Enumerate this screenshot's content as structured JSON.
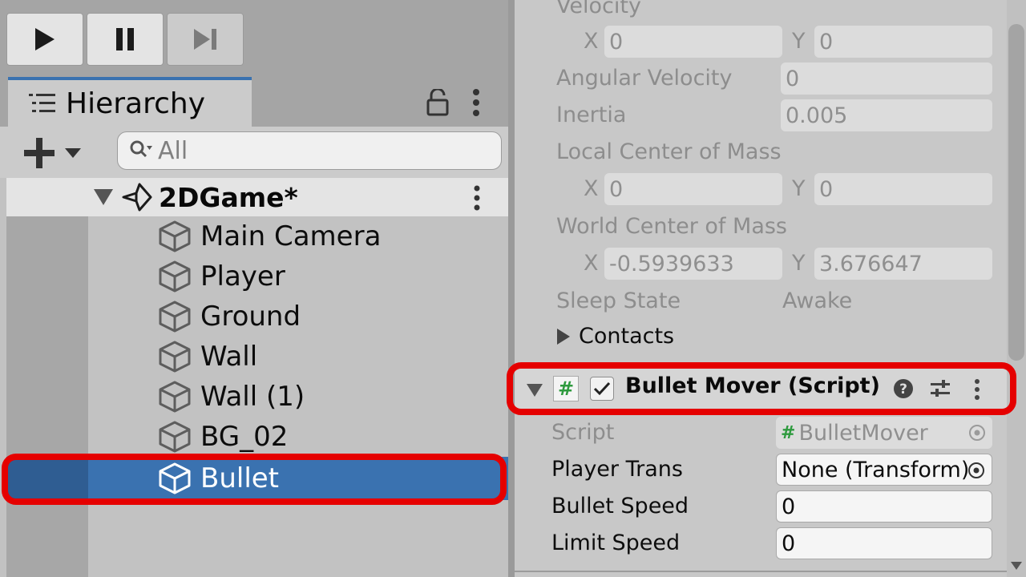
{
  "toolbar": {
    "play_icon": "play-icon",
    "pause_icon": "pause-icon",
    "step_icon": "step-icon"
  },
  "hierarchy": {
    "tab_label": "Hierarchy",
    "search_placeholder": "All",
    "scene_name": "2DGame*",
    "items": [
      {
        "label": "Main Camera"
      },
      {
        "label": "Player"
      },
      {
        "label": "Ground"
      },
      {
        "label": "Wall"
      },
      {
        "label": "Wall (1)"
      },
      {
        "label": "BG_02"
      },
      {
        "label": "Bullet"
      }
    ],
    "selected_item": "Bullet"
  },
  "inspector": {
    "rigidbody": {
      "velocity_label": "Velocity",
      "velocity": {
        "x_label": "X",
        "x": "0",
        "y_label": "Y",
        "y": "0"
      },
      "angular_velocity_label": "Angular Velocity",
      "angular_velocity": "0",
      "inertia_label": "Inertia",
      "inertia": "0.005",
      "local_com_label": "Local Center of Mass",
      "local_com": {
        "x_label": "X",
        "x": "0",
        "y_label": "Y",
        "y": "0"
      },
      "world_com_label": "World Center of Mass",
      "world_com": {
        "x_label": "X",
        "x": "-0.5939633",
        "y_label": "Y",
        "y": "3.676647"
      },
      "sleep_state_label": "Sleep State",
      "sleep_state": "Awake",
      "contacts_label": "Contacts"
    },
    "bullet_mover": {
      "title": "Bullet Mover (Script)",
      "enabled": true,
      "script_label": "Script",
      "script_value": "BulletMover",
      "script_glyph": "#",
      "player_trans_label": "Player Trans",
      "player_trans_value": "None (Transform)",
      "bullet_speed_label": "Bullet Speed",
      "bullet_speed_value": "0",
      "limit_speed_label": "Limit Speed",
      "limit_speed_value": "0"
    }
  },
  "colors": {
    "selection": "#3a72b0",
    "highlight": "#e50000",
    "script_icon": "#2e9a3e"
  }
}
